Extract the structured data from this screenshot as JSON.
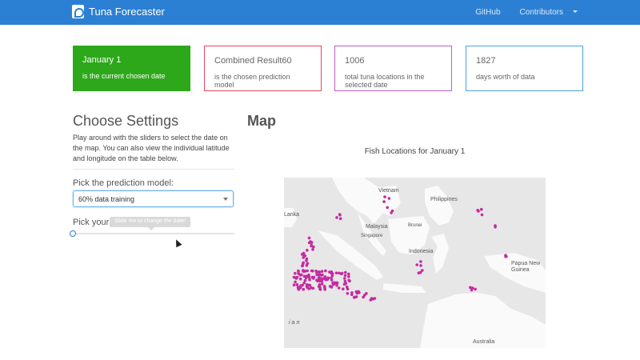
{
  "navbar": {
    "brand": "Tuna Forecaster",
    "github": "GitHub",
    "contributors": "Contributors"
  },
  "cards": [
    {
      "value": "January 1",
      "caption": "is the current chosen date"
    },
    {
      "value": "Combined Result60",
      "caption": "is the chosen prediction model"
    },
    {
      "value": "1006",
      "caption": "total tuna locations in the selected date"
    },
    {
      "value": "1827",
      "caption": "days worth of data"
    }
  ],
  "settings": {
    "title": "Choose Settings",
    "description": "Play around with the sliders to select the date on the map. You can also view the individual latitude and longitude on the table below.",
    "model_label": "Pick the prediction model:",
    "model_selected": "60% data training",
    "date_label": "Pick your date:",
    "slider_tooltip": "Slide me to change the date!",
    "slider_value": 0
  },
  "map": {
    "title": "Map",
    "subtitle": "Fish Locations for January 1",
    "labels": {
      "vietnam": "Vietnam",
      "philippines": "Philippines",
      "lanka": "Lanka",
      "malaysia": "Malaysia",
      "singapore": "Singapore",
      "brunei": "Brunei",
      "indonesia": "Indonesia",
      "papua": "Papua New Guinea",
      "australia": "Australia",
      "ocean": "ian"
    },
    "point_color": "#c42aa0",
    "land_color": "#fafafa",
    "water_color": "#e7e7e7"
  }
}
